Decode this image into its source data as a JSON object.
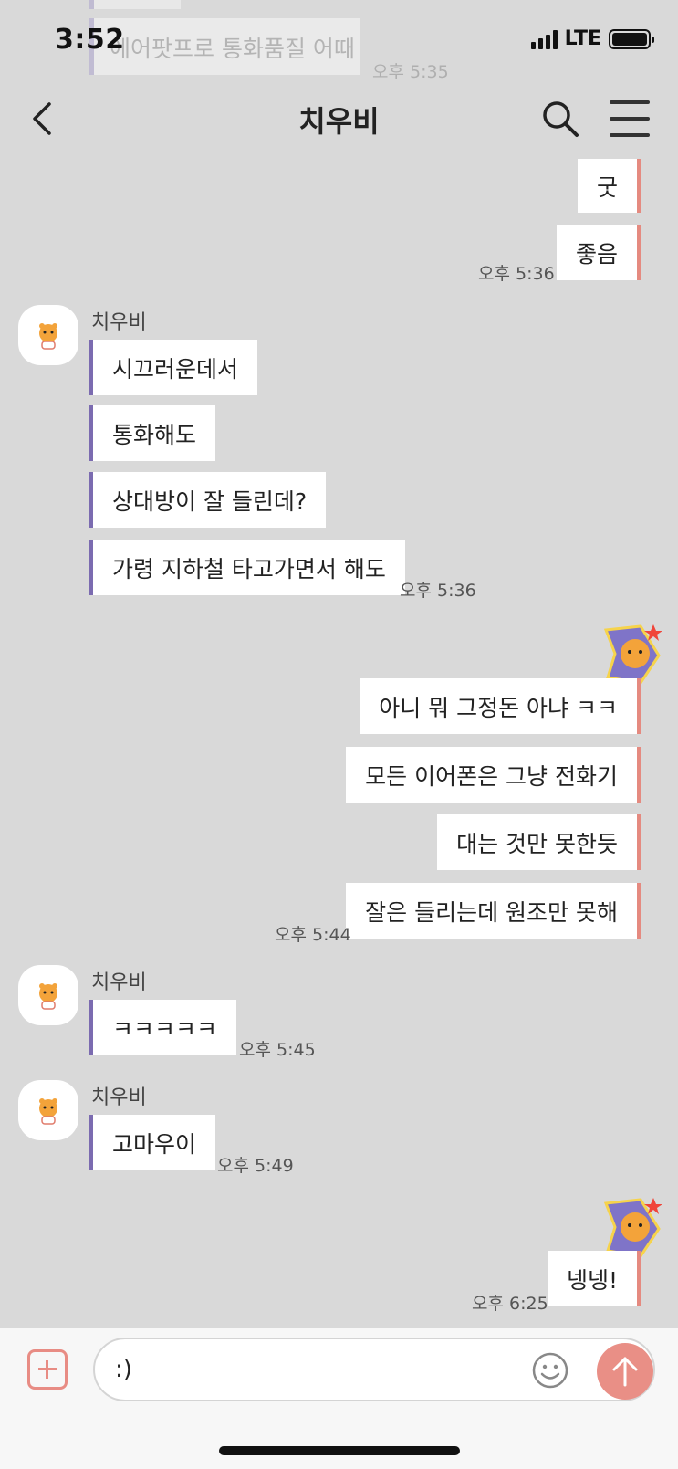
{
  "status": {
    "time": "3:52",
    "network": "LTE"
  },
  "ghost": {
    "text": "에어팟프로 통화품질 어때",
    "time": "오후 5:35"
  },
  "nav": {
    "title": "치우비"
  },
  "messages": {
    "out1": [
      "굿",
      "좋음"
    ],
    "out1_time": "오후 5:36",
    "in1_sender": "치우비",
    "in1": [
      "시끄러운데서",
      "통화해도",
      "상대방이 잘 들린데?",
      "가령 지하철 타고가면서 해도"
    ],
    "in1_time": "오후 5:36",
    "out2": [
      "아니 뭐 그정돈 아냐 ㅋㅋ",
      "모든 이어폰은 그냥 전화기",
      "대는 것만 못한듯",
      "잘은 들리는데 원조만 못해"
    ],
    "out2_time": "오후 5:44",
    "in2_sender": "치우비",
    "in2": [
      "ㅋㅋㅋㅋㅋ"
    ],
    "in2_time": "오후 5:45",
    "in3_sender": "치우비",
    "in3": [
      "고마우이"
    ],
    "in3_time": "오후 5:49",
    "out3": [
      "넹넹!"
    ],
    "out3_time": "오후 6:25"
  },
  "input": {
    "value": ":)"
  },
  "colors": {
    "incoming_accent": "#7b6bb0",
    "outgoing_accent": "#e58a80",
    "send_button": "#e98f86"
  }
}
